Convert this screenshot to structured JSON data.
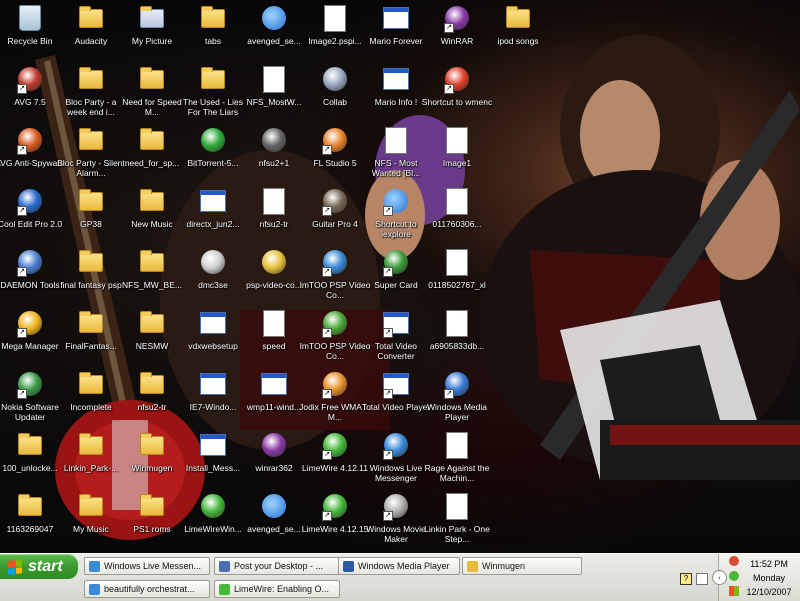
{
  "desktop": {
    "icons": [
      {
        "label": "Recycle Bin",
        "type": "recycle",
        "color": "#5aa0d8",
        "col": 0,
        "row": 0
      },
      {
        "label": "AVG 7.5",
        "type": "ball",
        "color": "#c03a2e",
        "col": 0,
        "row": 1,
        "shortcut": true
      },
      {
        "label": "AVG Anti-Spyware",
        "type": "ball",
        "color": "#d85a20",
        "col": 0,
        "row": 2,
        "shortcut": true
      },
      {
        "label": "Cool Edit Pro 2.0",
        "type": "ball",
        "color": "#2a6acc",
        "col": 0,
        "row": 3,
        "shortcut": true
      },
      {
        "label": "DAEMON Tools",
        "type": "ball",
        "color": "#4a7fd0",
        "col": 0,
        "row": 4,
        "shortcut": true
      },
      {
        "label": "Mega Manager",
        "type": "ball",
        "color": "#f1b41d",
        "col": 0,
        "row": 5,
        "shortcut": true
      },
      {
        "label": "Nokia Software Updater",
        "type": "ball",
        "color": "#3a9a4a",
        "col": 0,
        "row": 6,
        "shortcut": true
      },
      {
        "label": "100_unlocke...",
        "type": "folder",
        "col": 0,
        "row": 7
      },
      {
        "label": "1163269047",
        "type": "folder",
        "col": 0,
        "row": 8
      },
      {
        "label": "Audacity",
        "type": "folder",
        "col": 1,
        "row": 0
      },
      {
        "label": "Bloc Party - a week end i...",
        "type": "folder",
        "col": 1,
        "row": 1
      },
      {
        "label": "Bloc Party - Silent Alarm...",
        "type": "folder",
        "col": 1,
        "row": 2
      },
      {
        "label": "GP38",
        "type": "folder",
        "col": 1,
        "row": 3
      },
      {
        "label": "final fantasy psp",
        "type": "folder",
        "col": 1,
        "row": 4
      },
      {
        "label": "FinalFantas...",
        "type": "folder",
        "col": 1,
        "row": 5
      },
      {
        "label": "Incomplete",
        "type": "folder",
        "col": 1,
        "row": 6
      },
      {
        "label": "Linkin_Park-...",
        "type": "folder",
        "col": 1,
        "row": 7
      },
      {
        "label": "My Music",
        "type": "folder",
        "col": 1,
        "row": 8
      },
      {
        "label": "My Picture",
        "type": "folder-pic",
        "col": 2,
        "row": 0
      },
      {
        "label": "Need for Speed M...",
        "type": "folder",
        "col": 2,
        "row": 1
      },
      {
        "label": "need_for_sp...",
        "type": "folder",
        "col": 2,
        "row": 2
      },
      {
        "label": "New Music",
        "type": "folder",
        "col": 2,
        "row": 3
      },
      {
        "label": "NFS_MW_BE...",
        "type": "folder",
        "col": 2,
        "row": 4
      },
      {
        "label": "NESMW",
        "type": "folder",
        "col": 2,
        "row": 5
      },
      {
        "label": "nfsu2-tr",
        "type": "folder",
        "col": 2,
        "row": 6
      },
      {
        "label": "Winmugen",
        "type": "folder",
        "col": 2,
        "row": 7
      },
      {
        "label": "PS1 roms",
        "type": "folder",
        "col": 2,
        "row": 8
      },
      {
        "label": "tabs",
        "type": "folder",
        "col": 3,
        "row": 0
      },
      {
        "label": "The Used - Lies For The Liars",
        "type": "folder",
        "col": 3,
        "row": 1
      },
      {
        "label": "BitTorrent-5...",
        "type": "ball",
        "color": "#2eaa3a",
        "col": 3,
        "row": 2
      },
      {
        "label": "directx_jun2...",
        "type": "win",
        "col": 3,
        "row": 3
      },
      {
        "label": "dmc3se",
        "type": "ball",
        "color": "#cfcfcf",
        "col": 3,
        "row": 4
      },
      {
        "label": "vdxwebsetup",
        "type": "win",
        "col": 3,
        "row": 5
      },
      {
        "label": "IE7-Windo...",
        "type": "win",
        "col": 3,
        "row": 6
      },
      {
        "label": "Install_Mess...",
        "type": "win",
        "col": 3,
        "row": 7
      },
      {
        "label": "LimeWireWin...",
        "type": "ball",
        "color": "#46b83a",
        "col": 3,
        "row": 8
      },
      {
        "label": "avenged_se...",
        "type": "ie",
        "col": 4,
        "row": 0
      },
      {
        "label": "NFS_MostW...",
        "type": "doc",
        "col": 4,
        "row": 1
      },
      {
        "label": "nfsu2+1",
        "type": "ball",
        "color": "#666666",
        "col": 4,
        "row": 2
      },
      {
        "label": "nfsu2-tr",
        "type": "doc",
        "col": 4,
        "row": 3
      },
      {
        "label": "psp-video-co...",
        "type": "ball",
        "color": "#e6c23a",
        "col": 4,
        "row": 4
      },
      {
        "label": "speed",
        "type": "doc",
        "col": 4,
        "row": 5
      },
      {
        "label": "wmp11-wind...",
        "type": "win",
        "col": 4,
        "row": 6
      },
      {
        "label": "winrar362",
        "type": "ball",
        "color": "#8a3aa8",
        "col": 4,
        "row": 7
      },
      {
        "label": "avenged_se...",
        "type": "ie",
        "col": 4,
        "row": 8
      },
      {
        "label": "Image2.pspi...",
        "type": "doc",
        "col": 5,
        "row": 0
      },
      {
        "label": "Collab",
        "type": "ball",
        "color": "#9aa8c0",
        "col": 5,
        "row": 1
      },
      {
        "label": "FL Studio 5",
        "type": "ball",
        "color": "#e8832a",
        "col": 5,
        "row": 2,
        "shortcut": true
      },
      {
        "label": "Guitar Pro 4",
        "type": "ball",
        "color": "#7a6a5a",
        "col": 5,
        "row": 3,
        "shortcut": true
      },
      {
        "label": "ImTOO PSP Video Co...",
        "type": "ball",
        "color": "#3a8ad8",
        "col": 5,
        "row": 4,
        "shortcut": true
      },
      {
        "label": "ImTOO PSP Video Co...",
        "type": "ball",
        "color": "#4aa83a",
        "col": 5,
        "row": 5,
        "shortcut": true
      },
      {
        "label": "Jodix Free WMA to M...",
        "type": "ball",
        "color": "#e8902a",
        "col": 5,
        "row": 6,
        "shortcut": true
      },
      {
        "label": "LimeWire 4.12.11",
        "type": "ball",
        "color": "#46b83a",
        "col": 5,
        "row": 7,
        "shortcut": true
      },
      {
        "label": "LimeWire 4.12.15",
        "type": "ball",
        "color": "#46b83a",
        "col": 5,
        "row": 8,
        "shortcut": true
      },
      {
        "label": "Mario Forever",
        "type": "win",
        "col": 6,
        "row": 0
      },
      {
        "label": "Mario Info !",
        "type": "win",
        "col": 6,
        "row": 1
      },
      {
        "label": "NFS - Most Wanted [Bl...",
        "type": "doc",
        "col": 6,
        "row": 2
      },
      {
        "label": "Shortcut to iexplore",
        "type": "ie",
        "col": 6,
        "row": 3,
        "shortcut": true
      },
      {
        "label": "Super Card",
        "type": "ball",
        "color": "#3a9a3a",
        "col": 6,
        "row": 4,
        "shortcut": true
      },
      {
        "label": "Total Video Converter",
        "type": "win",
        "col": 6,
        "row": 5,
        "shortcut": true
      },
      {
        "label": "Total Video Player",
        "type": "win",
        "col": 6,
        "row": 6,
        "shortcut": true
      },
      {
        "label": "Windows Live Messenger",
        "type": "ball",
        "color": "#3a8ad8",
        "col": 6,
        "row": 7,
        "shortcut": true
      },
      {
        "label": "Windows Movie Maker",
        "type": "ball",
        "color": "#b0b0b0",
        "col": 6,
        "row": 8,
        "shortcut": true
      },
      {
        "label": "WinRAR",
        "type": "ball",
        "color": "#8a3aa8",
        "col": 7,
        "row": 0,
        "shortcut": true
      },
      {
        "label": "Shortcut to wmenc",
        "type": "ball",
        "color": "#e0402a",
        "col": 7,
        "row": 1,
        "shortcut": true
      },
      {
        "label": "Image1",
        "type": "doc",
        "col": 7,
        "row": 2
      },
      {
        "label": "011760306...",
        "type": "doc",
        "col": 7,
        "row": 3
      },
      {
        "label": "0118502767_xl",
        "type": "doc",
        "col": 7,
        "row": 4
      },
      {
        "label": "a6905833db...",
        "type": "doc",
        "col": 7,
        "row": 5
      },
      {
        "label": "Windows Media Player",
        "type": "ball",
        "color": "#3a7ad8",
        "col": 7,
        "row": 6,
        "shortcut": true
      },
      {
        "label": "Rage Against the Machin...",
        "type": "doc",
        "col": 7,
        "row": 7
      },
      {
        "label": "Linkin Park - One Step...",
        "type": "doc",
        "col": 7,
        "row": 8
      },
      {
        "label": "ipod songs",
        "type": "folder",
        "col": 8,
        "row": 0
      }
    ]
  },
  "taskbar": {
    "start_label": "start",
    "tasks": [
      {
        "label": "Windows Live Messen...",
        "color": "#3a8ad8"
      },
      {
        "label": "Post your Desktop - ...",
        "color": "#4a6fb0"
      },
      {
        "label": "Windows Media Player",
        "color": "#2a5aa8"
      },
      {
        "label": "Winmugen",
        "color": "#e9b93c"
      },
      {
        "label": "beautifully orchestrat...",
        "color": "#3a8ad8"
      },
      {
        "label": "LimeWire: Enabling O...",
        "color": "#46b83a"
      }
    ],
    "tray": {
      "time": "11:52 PM",
      "day": "Monday",
      "date": "12/10/2007"
    }
  }
}
